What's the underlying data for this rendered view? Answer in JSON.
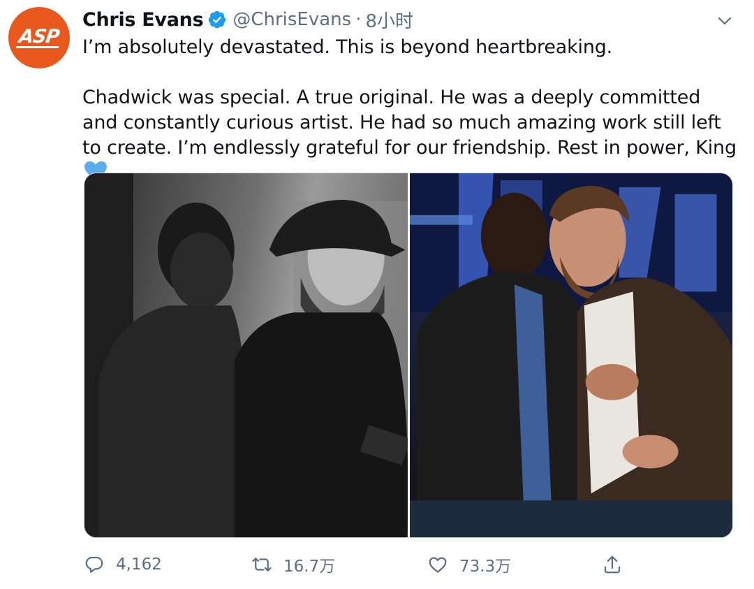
{
  "avatar": {
    "text": "ASP",
    "color": "#e8581d"
  },
  "author": {
    "display_name": "Chris Evans",
    "verified_icon": "verified-badge-icon",
    "handle": "@ChrisEvans",
    "separator": "·",
    "time": "8小时"
  },
  "tweet": {
    "paragraph_1": "I’m absolutely devastated. This is beyond heartbreaking.",
    "paragraph_2": "Chadwick was special. A true original. He was a deeply committed and constantly curious artist. He had so much amazing work still left to create. I’m endlessly grateful for our friendship. Rest in power, King",
    "emoji": "blue-heart-icon"
  },
  "media": {
    "count": 2,
    "items": [
      {
        "type": "photo",
        "tone": "black-and-white"
      },
      {
        "type": "photo",
        "tone": "color"
      }
    ]
  },
  "actions": {
    "reply_count": "4,162",
    "retweet_count": "16.7万",
    "like_count": "73.3万",
    "share_icon": "share-icon"
  },
  "colors": {
    "text": "#0f1419",
    "secondary": "#5b7083",
    "verified": "#1d9bf0",
    "heart": "#5dadec"
  }
}
